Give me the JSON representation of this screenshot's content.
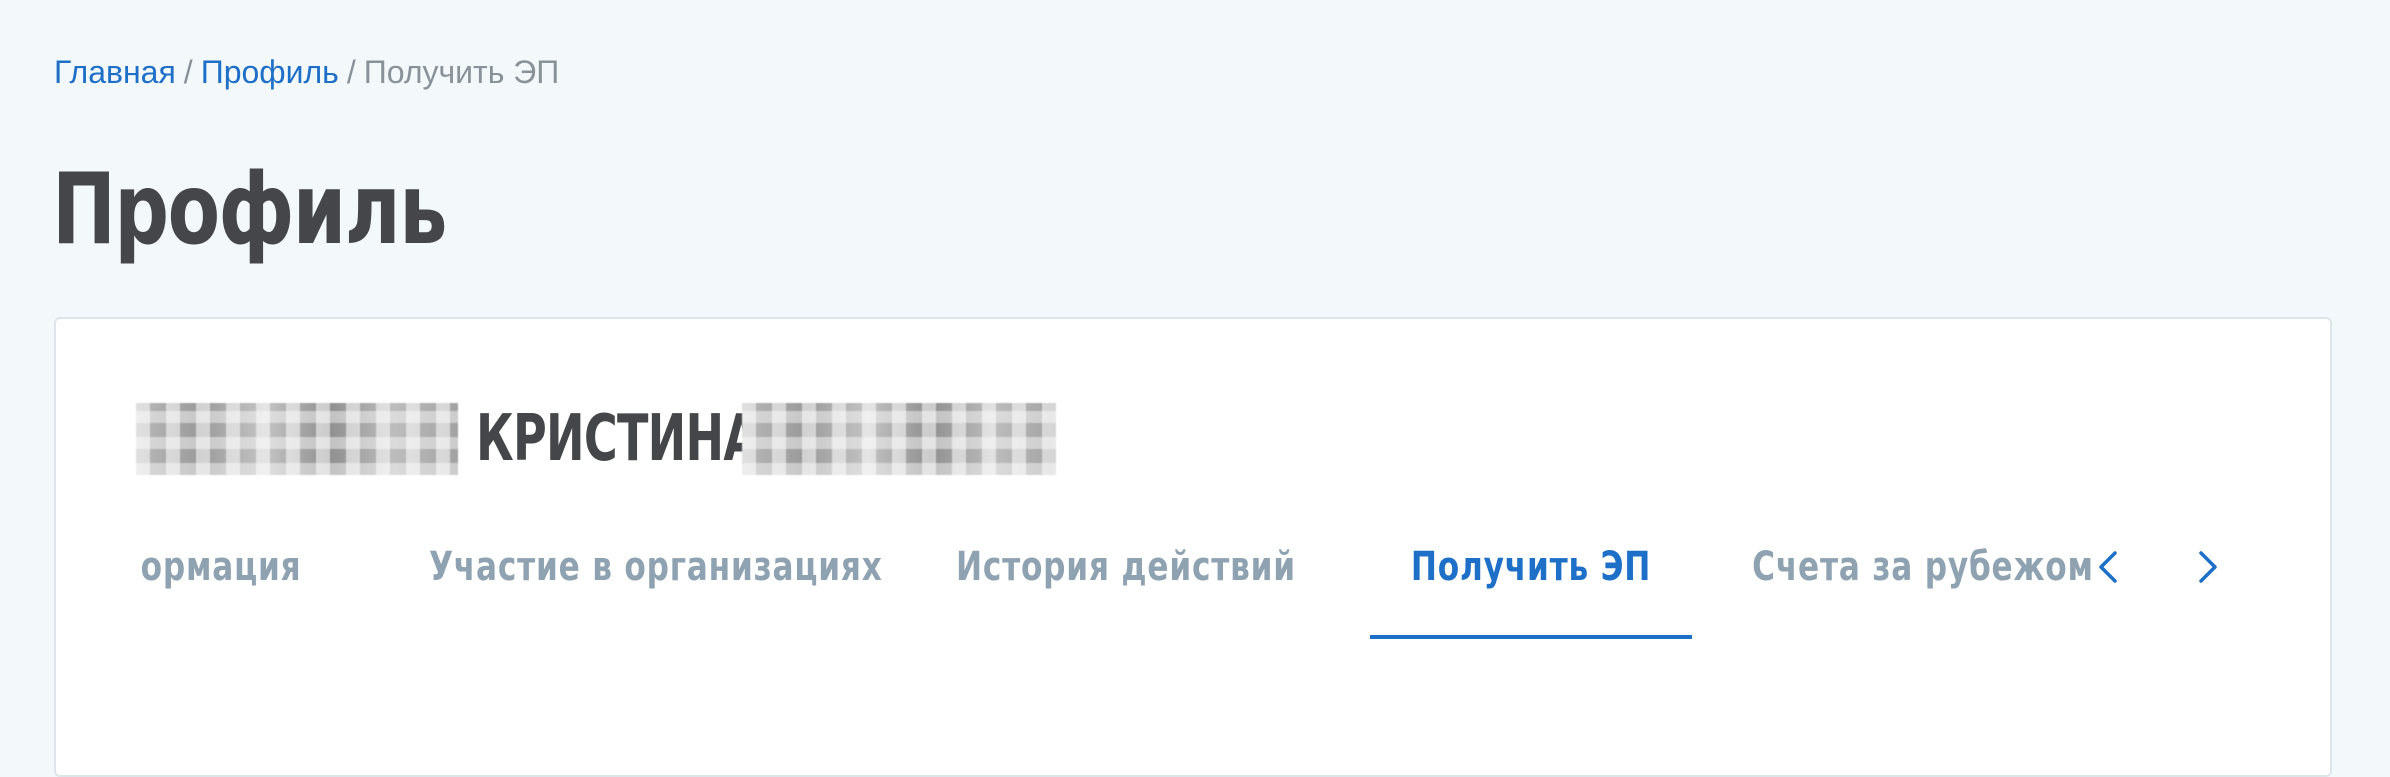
{
  "breadcrumb": {
    "home": "Главная",
    "separator": "/",
    "profile": "Профиль",
    "current": "Получить ЭП"
  },
  "page": {
    "title": "Профиль"
  },
  "profile_card": {
    "first_name": "КРИСТИНА"
  },
  "tabs": [
    {
      "label": "Информация",
      "visible_label": "ормация",
      "active": false
    },
    {
      "label": "Участие в организациях",
      "active": false
    },
    {
      "label": "История действий",
      "active": false
    },
    {
      "label": "Получить ЭП",
      "active": true
    },
    {
      "label": "Счета за рубежом",
      "active": false
    }
  ],
  "icons": {
    "prev": "chevron-left-icon",
    "next": "chevron-right-icon"
  },
  "colors": {
    "background": "#f3f8fb",
    "accent": "#1d6fc7",
    "title": "#444649",
    "tab_inactive": "#8fa2b2",
    "breadcrumb_muted": "#8a9299"
  }
}
